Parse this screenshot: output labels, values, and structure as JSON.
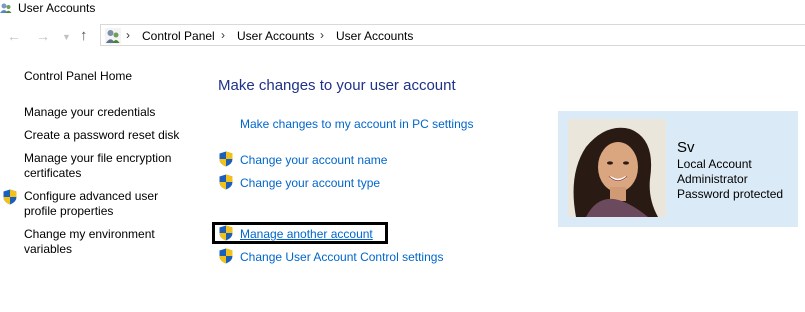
{
  "window": {
    "title": "User Accounts"
  },
  "addressbar": {
    "crumbs": [
      "Control Panel",
      "User Accounts",
      "User Accounts"
    ]
  },
  "sidebar": {
    "home": "Control Panel Home",
    "items": [
      {
        "label": "Manage your credentials",
        "shield": false
      },
      {
        "label": "Create a password reset disk",
        "shield": false
      },
      {
        "label": "Manage your file encryption certificates",
        "shield": false
      },
      {
        "label": "Configure advanced user profile properties",
        "shield": true
      },
      {
        "label": "Change my environment variables",
        "shield": false
      }
    ]
  },
  "main": {
    "heading": "Make changes to your user account",
    "tasks": [
      {
        "label": "Make changes to my account in PC settings",
        "shield": false
      },
      {
        "label": "Change your account name",
        "shield": true
      },
      {
        "label": "Change your account type",
        "shield": true
      },
      {
        "label": "Manage another account",
        "shield": true,
        "highlighted": true
      },
      {
        "label": "Change User Account Control settings",
        "shield": true
      }
    ]
  },
  "account": {
    "name": "Sv",
    "type": "Local Account",
    "role": "Administrator",
    "status": "Password protected"
  },
  "colors": {
    "link": "#0066cc",
    "heading": "#1e3287",
    "panel": "#daeaf7",
    "highlight_border": "#000000"
  },
  "icons": [
    "user-accounts-icon",
    "back-arrow-icon",
    "forward-arrow-icon",
    "recent-dropdown-icon",
    "up-arrow-icon",
    "uac-shield-icon"
  ]
}
